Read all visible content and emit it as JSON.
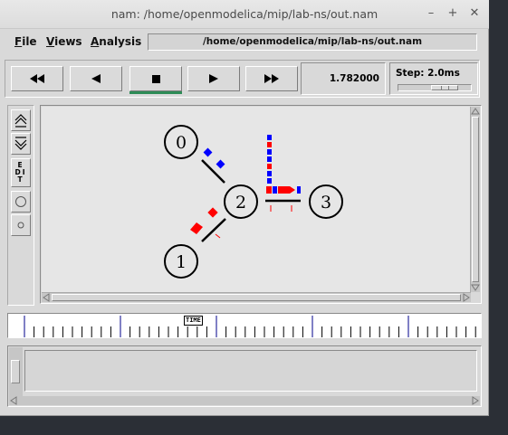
{
  "window": {
    "title": "nam: /home/openmodelica/mip/lab-ns/out.nam",
    "controls": {
      "minimize": "–",
      "maximize": "+",
      "close": "✕"
    }
  },
  "menu": {
    "items": [
      "File",
      "Views",
      "Analysis"
    ],
    "file_path": "/home/openmodelica/mip/lab-ns/out.nam"
  },
  "playback": {
    "buttons": [
      "rewind",
      "step-back",
      "stop",
      "play",
      "fast-forward"
    ],
    "active": "stop",
    "current_time": "1.782000",
    "step_label": "Step: 2.0ms"
  },
  "tools": {
    "edit_label": "EDIT"
  },
  "network": {
    "nodes": [
      {
        "id": "0",
        "label": "0"
      },
      {
        "id": "1",
        "label": "1"
      },
      {
        "id": "2",
        "label": "2"
      },
      {
        "id": "3",
        "label": "3"
      }
    ],
    "links": [
      [
        "0",
        "2"
      ],
      [
        "1",
        "2"
      ],
      [
        "2",
        "3"
      ]
    ],
    "colors": {
      "red_packet": "#ff0000",
      "blue_packet": "#0000ff",
      "link": "#000000"
    }
  },
  "timeline": {
    "marker_label": "TIME"
  }
}
